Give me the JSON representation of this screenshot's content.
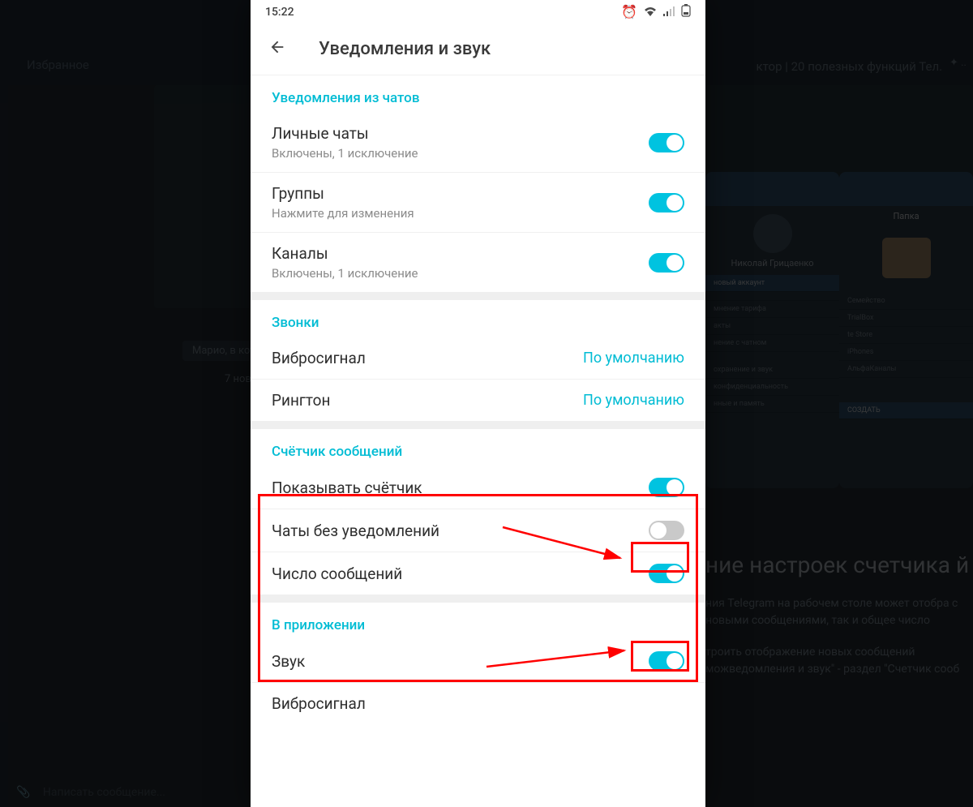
{
  "bg": {
    "sidebar_title": "Избранное",
    "tab_text": "ктор | 20 полезных функций Тел...",
    "pin": "✦ ..",
    "caption1": "Марио, в кото...",
    "date": "7 нов...",
    "thumb1_name": "Николай Грицаенко",
    "thumb1_items": [
      "новый аккаунт",
      "",
      "мнение тарифа",
      "акты",
      "нение с чатном"
    ],
    "thumb1_bottom": [
      "охранение и звук",
      "конфиденциальность",
      "нные и память"
    ],
    "thumb2_title": "Папка",
    "thumb2_items": [
      "Семейство",
      "TrialBox",
      "te Store",
      "iPhones",
      "АльфаКаналы"
    ],
    "thumb2_new": "СОЗДАТЬ",
    "article_h": "ние настроек счетчика й",
    "article_p1": "ния Telegram на рабочем столе может отобра с новыми сообщениями, так и общее число",
    "article_p2": "троить отображение новых сообщений можведомления и звук\" - раздел \"Счетчик сооб",
    "input_placeholder": "Написать сообщение..."
  },
  "status": {
    "time": "15:22"
  },
  "appbar": {
    "title": "Уведомления и звук"
  },
  "sections": {
    "chats": {
      "head": "Уведомления из чатов",
      "personal": {
        "label": "Личные чаты",
        "sub": "Включены, 1 исключение"
      },
      "groups": {
        "label": "Группы",
        "sub": "Нажмите для изменения"
      },
      "channels": {
        "label": "Каналы",
        "sub": "Включены, 1 исключение"
      }
    },
    "calls": {
      "head": "Звонки",
      "vibro": {
        "label": "Вибросигнал",
        "value": "По умолчанию"
      },
      "ringtone": {
        "label": "Рингтон",
        "value": "По умолчанию"
      }
    },
    "counter": {
      "head": "Счётчик сообщений",
      "show": {
        "label": "Показывать счётчик"
      },
      "muted": {
        "label": "Чаты без уведомлений"
      },
      "count": {
        "label": "Число сообщений"
      }
    },
    "inapp": {
      "head": "В приложении",
      "sound": {
        "label": "Звук"
      },
      "vibro2": {
        "label": "Вибросигнал"
      }
    }
  }
}
